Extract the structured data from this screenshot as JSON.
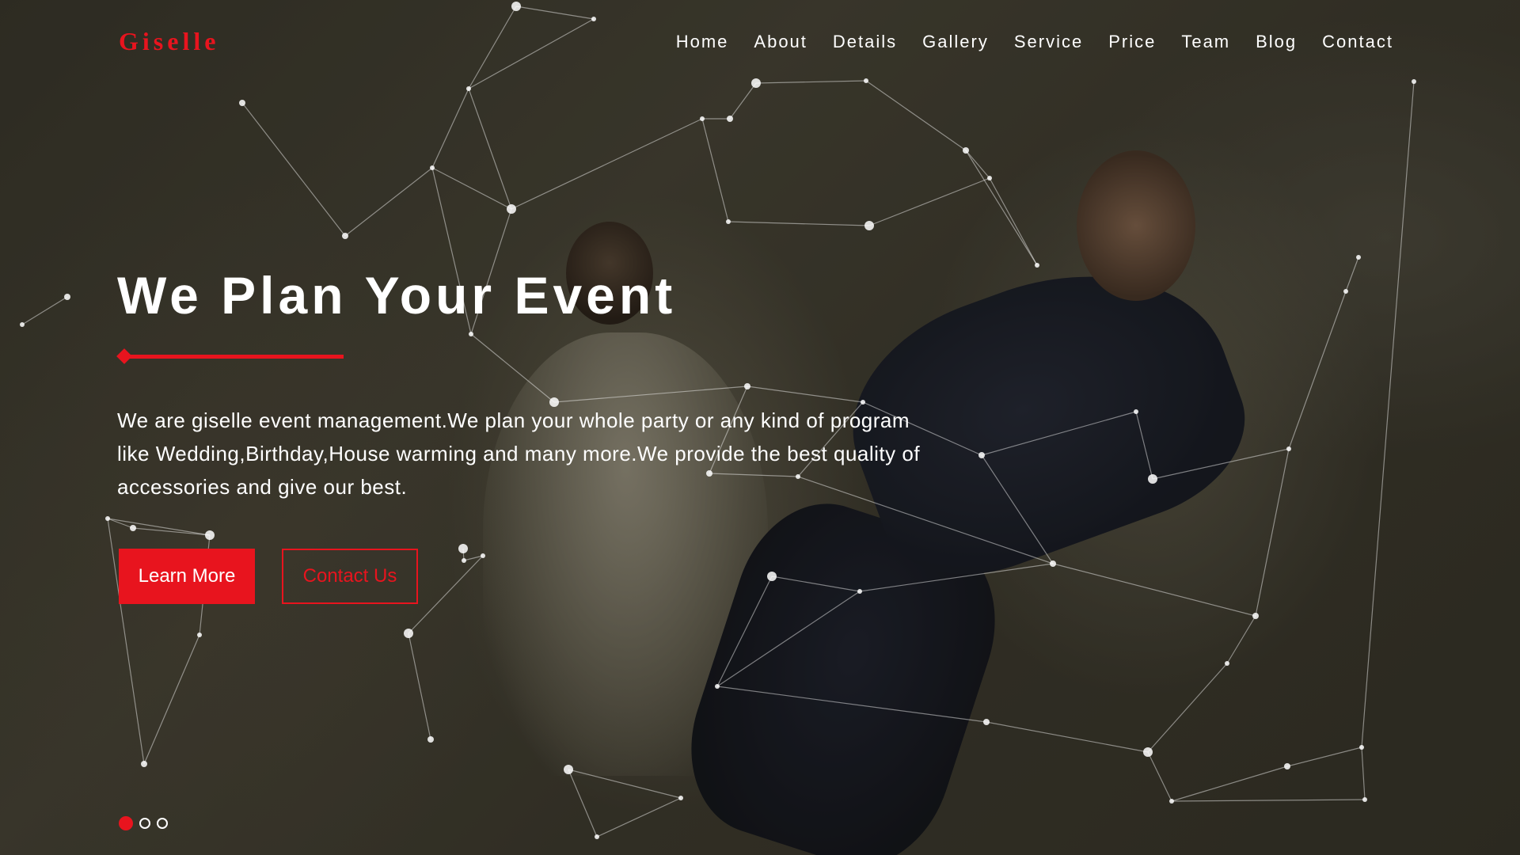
{
  "brand": {
    "logo_text": "Giselle",
    "accent_color": "#e8141e"
  },
  "nav": {
    "items": [
      {
        "label": "Home"
      },
      {
        "label": "About"
      },
      {
        "label": "Details"
      },
      {
        "label": "Gallery"
      },
      {
        "label": "Service"
      },
      {
        "label": "Price"
      },
      {
        "label": "Team"
      },
      {
        "label": "Blog"
      },
      {
        "label": "Contact"
      }
    ]
  },
  "hero": {
    "title": "We Plan Your Event",
    "description": "We are giselle event management.We plan your whole party or any kind of program like Wedding,Birthday,House warming and many more.We provide the best quality of accessories and give our best.",
    "primary_button": "Learn More",
    "secondary_button": "Contact Us",
    "slider": {
      "total_slides": 3,
      "active_slide": 1
    }
  }
}
